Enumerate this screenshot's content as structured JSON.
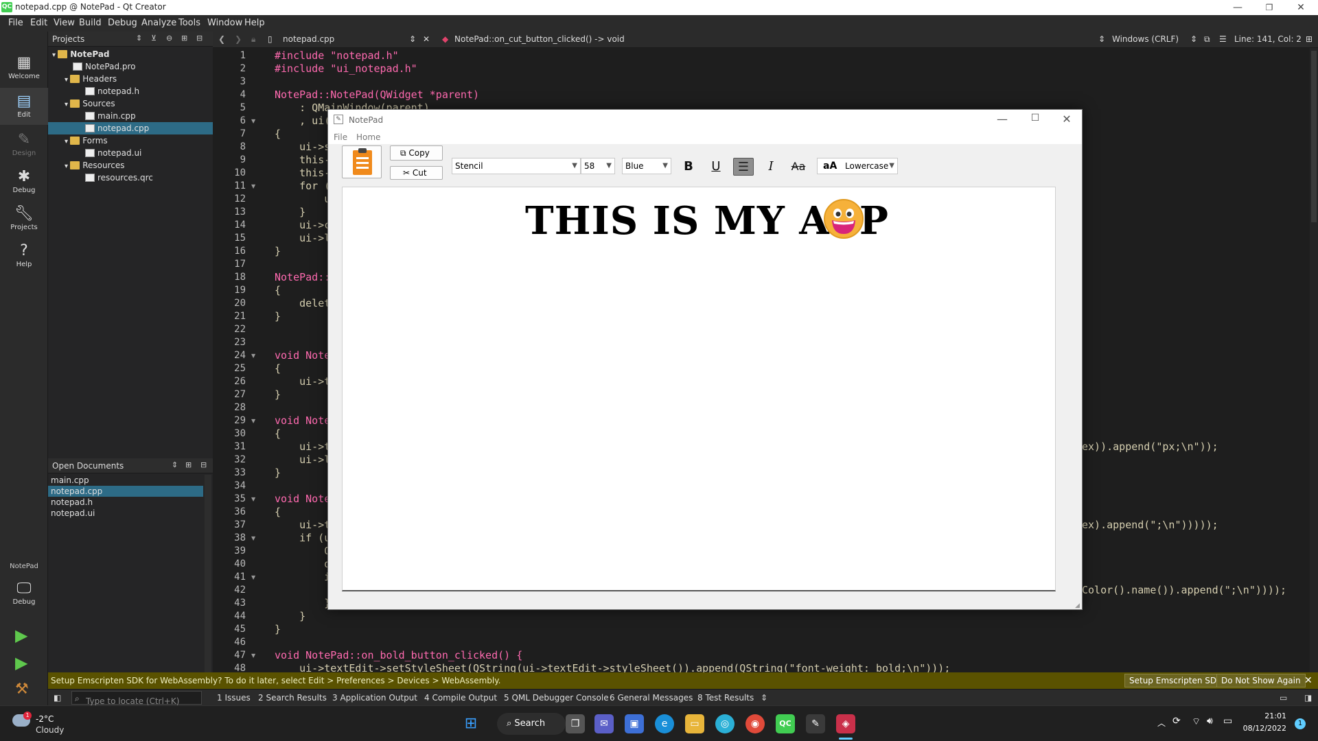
{
  "window": {
    "title": "notepad.cpp @ NotePad - Qt Creator",
    "app_icon": "QC"
  },
  "menubar": [
    "File",
    "Edit",
    "View",
    "Build",
    "Debug",
    "Analyze",
    "Tools",
    "Window",
    "Help"
  ],
  "modes": {
    "welcome": "Welcome",
    "edit": "Edit",
    "design": "Design",
    "debug": "Debug",
    "projects": "Projects",
    "help": "Help",
    "kit_project": "NotePad",
    "kit_mode": "Debug"
  },
  "projects_panel": {
    "title": "Projects",
    "tree": [
      {
        "label": "NotePad",
        "kind": "project"
      },
      {
        "label": "NotePad.pro",
        "kind": "file"
      },
      {
        "label": "Headers",
        "kind": "folder"
      },
      {
        "label": "notepad.h",
        "kind": "file"
      },
      {
        "label": "Sources",
        "kind": "folder"
      },
      {
        "label": "main.cpp",
        "kind": "file"
      },
      {
        "label": "notepad.cpp",
        "kind": "file",
        "selected": true
      },
      {
        "label": "Forms",
        "kind": "folder"
      },
      {
        "label": "notepad.ui",
        "kind": "file"
      },
      {
        "label": "Resources",
        "kind": "folder"
      },
      {
        "label": "resources.qrc",
        "kind": "file"
      }
    ]
  },
  "open_documents": {
    "title": "Open Documents",
    "items": [
      "main.cpp",
      "notepad.cpp",
      "notepad.h",
      "notepad.ui"
    ]
  },
  "editor_toolbar": {
    "file": "notepad.cpp",
    "symbol": "NotePad::on_cut_button_clicked() -> void",
    "line_ending": "Windows (CRLF)",
    "position": "Line: 141, Col: 2"
  },
  "code_lines": [
    {
      "n": "1",
      "text": "#include \"notepad.h\""
    },
    {
      "n": "2",
      "text": "#include \"ui_notepad.h\""
    },
    {
      "n": "3",
      "text": ""
    },
    {
      "n": "4",
      "text": "NotePad::NotePad(QWidget *parent)"
    },
    {
      "n": "5",
      "text": "    : QMainWindow(parent)"
    },
    {
      "n": "6",
      "text": "    , ui(n"
    },
    {
      "n": "7",
      "text": "{"
    },
    {
      "n": "8",
      "text": "    ui->se"
    },
    {
      "n": "9",
      "text": "    this->"
    },
    {
      "n": "10",
      "text": "    this->"
    },
    {
      "n": "11",
      "text": "    for (i"
    },
    {
      "n": "12",
      "text": "        ui"
    },
    {
      "n": "13",
      "text": "    }"
    },
    {
      "n": "14",
      "text": "    ui->co"
    },
    {
      "n": "15",
      "text": "    ui->li"
    },
    {
      "n": "16",
      "text": "}"
    },
    {
      "n": "17",
      "text": ""
    },
    {
      "n": "18",
      "text": "NotePad::~"
    },
    {
      "n": "19",
      "text": "{"
    },
    {
      "n": "20",
      "text": "    delete"
    },
    {
      "n": "21",
      "text": "}"
    },
    {
      "n": "22",
      "text": ""
    },
    {
      "n": "23",
      "text": ""
    },
    {
      "n": "24",
      "text": "void NoteP"
    },
    {
      "n": "25",
      "text": "{"
    },
    {
      "n": "26",
      "text": "    ui->te"
    },
    {
      "n": "27",
      "text": "}"
    },
    {
      "n": "28",
      "text": ""
    },
    {
      "n": "29",
      "text": "void NoteP"
    },
    {
      "n": "30",
      "text": "{"
    },
    {
      "n": "31",
      "text": "    ui->te"
    },
    {
      "n": "32",
      "text": "    ui->li"
    },
    {
      "n": "33",
      "text": "}"
    },
    {
      "n": "34",
      "text": ""
    },
    {
      "n": "35",
      "text": "void NoteP"
    },
    {
      "n": "36",
      "text": "{"
    },
    {
      "n": "37",
      "text": "    ui->te"
    },
    {
      "n": "38",
      "text": "    if (ui"
    },
    {
      "n": "39",
      "text": "        QC"
    },
    {
      "n": "40",
      "text": "        di"
    },
    {
      "n": "41",
      "text": "        if"
    },
    {
      "n": "42",
      "text": ""
    },
    {
      "n": "43",
      "text": "        }"
    },
    {
      "n": "44",
      "text": "    }"
    },
    {
      "n": "45",
      "text": "}"
    },
    {
      "n": "46",
      "text": ""
    },
    {
      "n": "47",
      "text": "void NotePad::on_bold_button_clicked() {"
    },
    {
      "n": "48",
      "text": "    ui->textEdit->setStyleSheet(QString(ui->textEdit->styleSheet()).append(QString(\"font-weight: bold;\\n\")));"
    }
  ],
  "code_tails": [
    {
      "line": "31",
      "text": "ex)).append(\"px;\\n\"));"
    },
    {
      "line": "37",
      "text": "ex).append(\";\\n\")))));"
    },
    {
      "line": "42",
      "text": "Color().name()).append(\";\\n\"))));"
    }
  ],
  "notepad": {
    "title": "NotePad",
    "menu": [
      "File",
      "Home"
    ],
    "copy_label": "Copy",
    "cut_label": "Cut",
    "font": "Stencil",
    "size": "58",
    "color": "Blue",
    "case": "Lowercase",
    "bold": "B",
    "underline": "U",
    "italic": "I",
    "strike": "Aa",
    "case_icon": "aA",
    "content": "THIS IS MY APP",
    "emoji": "grinning-face"
  },
  "notification": {
    "message": "Setup Emscripten SDK for WebAssembly? To do it later, select Edit > Preferences > Devices > WebAssembly.",
    "setup_button": "Setup Emscripten SDK",
    "dismiss_button": "Do Not Show Again"
  },
  "output_panes": {
    "locate_placeholder": "Type to locate (Ctrl+K)",
    "tabs": [
      "1  Issues",
      "2  Search Results",
      "3  Application Output",
      "4  Compile Output",
      "5  QML Debugger Console",
      "6  General Messages",
      "8  Test Results"
    ]
  },
  "taskbar": {
    "weather_temp": "-2°C",
    "weather_desc": "Cloudy",
    "weather_badge": "1",
    "search_label": "Search",
    "time": "21:01",
    "date": "08/12/2022",
    "notif_count": "1"
  }
}
